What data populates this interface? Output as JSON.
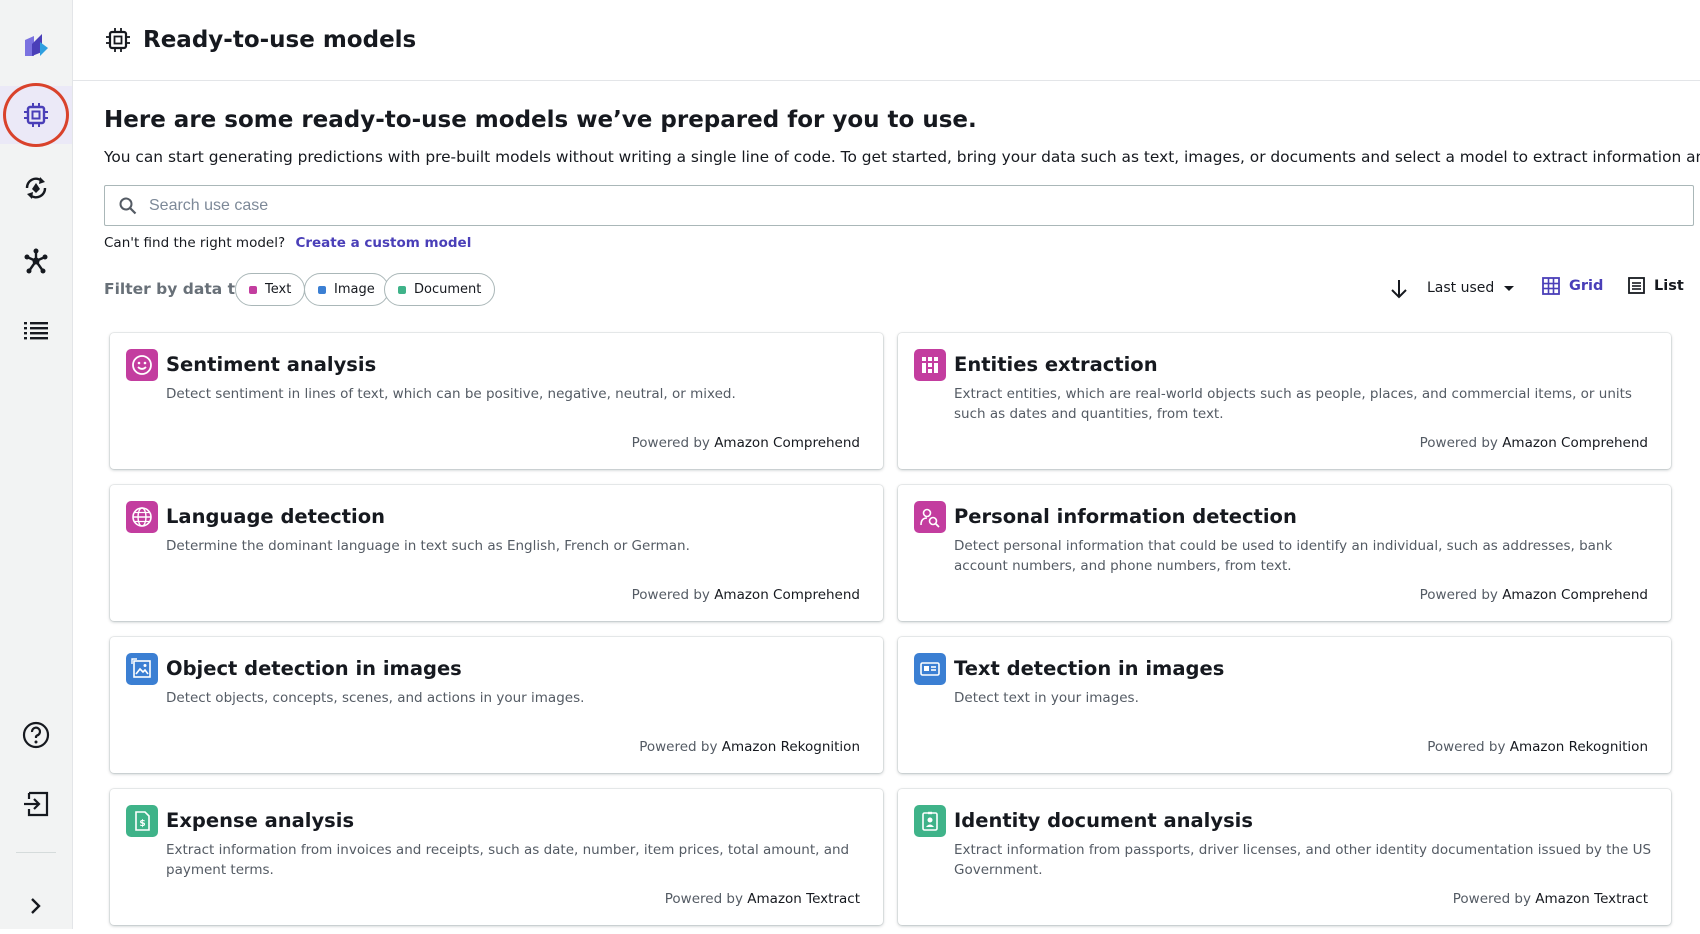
{
  "header": {
    "title": "Ready-to-use models"
  },
  "main": {
    "headline": "Here are some ready-to-use models we’ve prepared for you to use.",
    "subline": "You can start generating predictions with pre-built models without writing a single line of code. To get started, bring your data such as text, images, or documents and select a model to extract information and insights.",
    "search": {
      "placeholder": "Search use case",
      "value": ""
    },
    "cant_find": "Can't find the right model?",
    "custom_model_link": "Create a custom model",
    "filter": {
      "label": "Filter by data type:",
      "chips": [
        {
          "label": "Text",
          "color": "#c33d9f"
        },
        {
          "label": "Image",
          "color": "#3b7fd3"
        },
        {
          "label": "Document",
          "color": "#3fb389"
        }
      ]
    },
    "sort": {
      "value": "Last used"
    },
    "view": {
      "grid": "Grid",
      "list": "List",
      "selected": "Grid"
    },
    "powered_prefix": "Powered by",
    "cards": [
      {
        "title": "Sentiment analysis",
        "desc": "Detect sentiment in lines of text, which can be positive, negative, neutral, or mixed.",
        "service": "Amazon Comprehend",
        "icon": "smile-icon",
        "color": "#c33d9f"
      },
      {
        "title": "Entities extraction",
        "desc": "Extract entities, which are real-world objects such as people, places, and commercial items, or units such as dates and quantities, from text.",
        "service": "Amazon Comprehend",
        "icon": "entities-icon",
        "color": "#c33d9f"
      },
      {
        "title": "Language detection",
        "desc": "Determine the dominant language in text such as English, French or German.",
        "service": "Amazon Comprehend",
        "icon": "globe-icon",
        "color": "#c33d9f"
      },
      {
        "title": "Personal information detection",
        "desc": "Detect personal information that could be used to identify an individual, such as addresses, bank account numbers, and phone numbers, from text.",
        "service": "Amazon Comprehend",
        "icon": "person-search-icon",
        "color": "#c33d9f"
      },
      {
        "title": "Object detection in images",
        "desc": "Detect objects, concepts, scenes, and actions in your images.",
        "service": "Amazon Rekognition",
        "icon": "image-icon",
        "color": "#3b7fd3"
      },
      {
        "title": "Text detection in images",
        "desc": "Detect text in your images.",
        "service": "Amazon Rekognition",
        "icon": "text-card-icon",
        "color": "#3b7fd3"
      },
      {
        "title": "Expense analysis",
        "desc": "Extract information from invoices and receipts, such as date, number, item prices, total amount, and payment terms.",
        "service": "Amazon Textract",
        "icon": "invoice-icon",
        "color": "#3fb389"
      },
      {
        "title": "Identity document analysis",
        "desc": "Extract information from passports, driver licenses, and other identity documentation issued by the US Government.",
        "service": "Amazon Textract",
        "icon": "id-badge-icon",
        "color": "#3fb389"
      }
    ]
  }
}
